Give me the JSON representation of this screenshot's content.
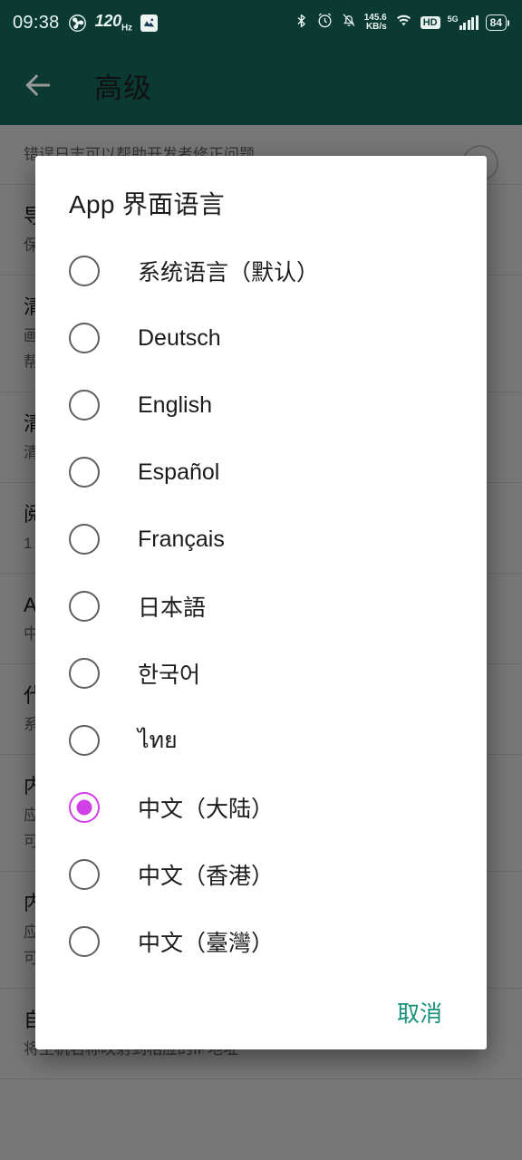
{
  "status_bar": {
    "time": "09:38",
    "fan_icon": "fan-icon",
    "refresh_rate": "120",
    "refresh_rate_unit": "Hz",
    "app_badge_icon": "app-badge-icon",
    "bluetooth_icon": "bluetooth-icon",
    "alarm_icon": "alarm-icon",
    "mute_icon": "notification-mute-icon",
    "network_speed_value": "145.6",
    "network_speed_unit": "KB/s",
    "wifi_icon": "wifi-icon",
    "hd_label": "HD",
    "signal_generation": "5G",
    "signal_icon": "cellular-signal-icon",
    "battery_level": "84"
  },
  "toolbar": {
    "back_icon": "back-arrow-icon",
    "title": "高级"
  },
  "background_page": {
    "rows": [
      {
        "title": "",
        "subtitle": "错误日志可以帮助开发者修正问题",
        "has_switch": true
      },
      {
        "title": "导出日志",
        "subtitle": "保存错误日志到文件",
        "has_switch": false
      },
      {
        "title": "清除图片缓存",
        "subtitle": "画廊缓存占用空间",
        "subtitle2": "帮助释放存储空间",
        "has_switch": false
      },
      {
        "title": "清除网页缓存",
        "subtitle": "清除浏览器缓存数据",
        "has_switch": false
      },
      {
        "title": "阅读模式",
        "subtitle": "1",
        "has_switch": false
      },
      {
        "title": "App 界面语言",
        "subtitle": "中文（大陆）",
        "has_switch": false
      },
      {
        "title": "代理设置",
        "subtitle": "系统代理",
        "has_switch": false
      },
      {
        "title": "内置 hosts",
        "subtitle": "应用内置的 hosts 规则",
        "subtitle2": "可被自定义 hosts.txt 覆盖",
        "has_switch": false
      },
      {
        "title": "内置 DNS",
        "subtitle": "应用内置的 DNS 规则",
        "subtitle2": "可被自定义 hosts.txt 覆盖",
        "has_switch": false
      },
      {
        "title": "自定义 hosts.txt",
        "subtitle": "将主机名称映射到相应的IP地址",
        "has_switch": false
      }
    ]
  },
  "dialog": {
    "title": "App 界面语言",
    "selected_index": 8,
    "options": [
      {
        "label": "系统语言（默认）",
        "selected": false
      },
      {
        "label": "Deutsch",
        "selected": false
      },
      {
        "label": "English",
        "selected": false
      },
      {
        "label": "Español",
        "selected": false
      },
      {
        "label": "Français",
        "selected": false
      },
      {
        "label": "日本語",
        "selected": false
      },
      {
        "label": "한국어",
        "selected": false
      },
      {
        "label": "ไทย",
        "selected": false
      },
      {
        "label": "中文（大陆）",
        "selected": true
      },
      {
        "label": "中文（香港）",
        "selected": false
      },
      {
        "label": "中文（臺灣）",
        "selected": false
      }
    ],
    "cancel_label": "取消"
  },
  "colors": {
    "status_bar_bg": "#0b3a33",
    "toolbar_bg": "#0b3a33",
    "accent_selected_radio": "#d13fe8",
    "accent_action_text": "#179079",
    "dialog_bg": "#ffffff",
    "scrim": "rgba(0,0,0,0.53)"
  }
}
